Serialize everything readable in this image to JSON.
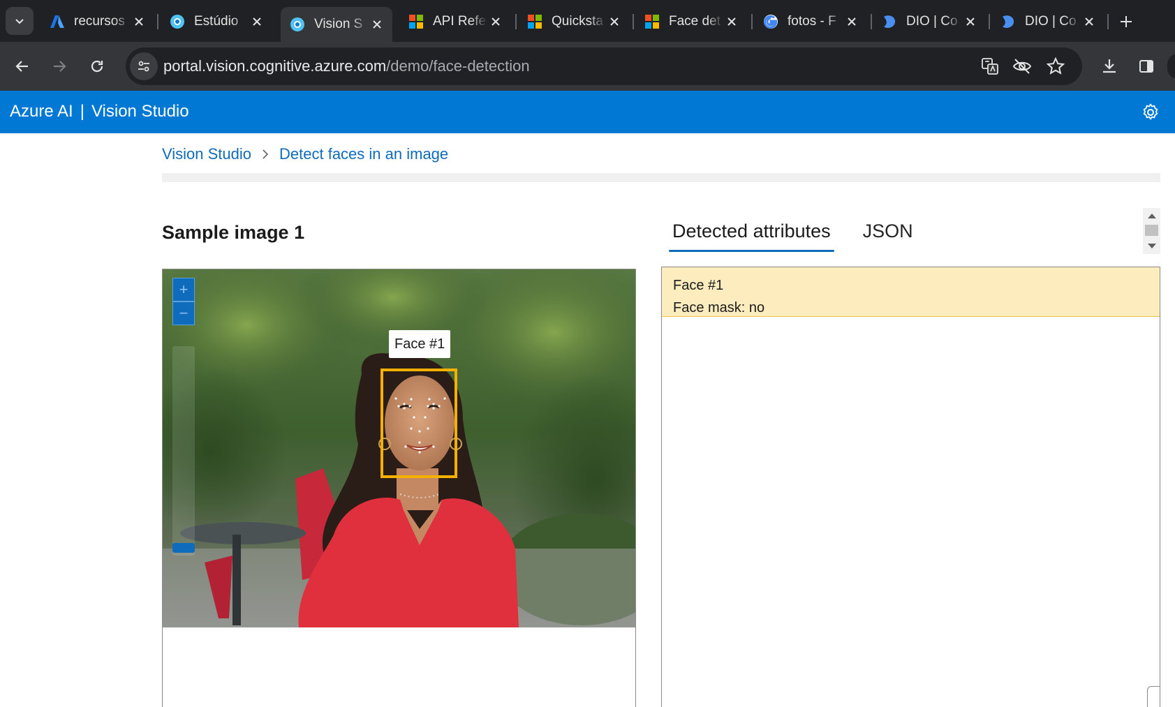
{
  "browser": {
    "tabs": [
      {
        "title": "recursos",
        "favicon": "azure-icon",
        "active": false
      },
      {
        "title": "Estúdio",
        "favicon": "vision-studio-icon",
        "active": false
      },
      {
        "title": "Vision S",
        "favicon": "vision-studio-icon",
        "active": true
      },
      {
        "title": "API Refe",
        "favicon": "microsoft-icon",
        "active": false
      },
      {
        "title": "Quicksta",
        "favicon": "microsoft-icon",
        "active": false
      },
      {
        "title": "Face det",
        "favicon": "microsoft-icon",
        "active": false
      },
      {
        "title": "fotos - F",
        "favicon": "google-icon",
        "active": false
      },
      {
        "title": "DIO | Co",
        "favicon": "dio-icon",
        "active": false
      },
      {
        "title": "DIO | Co",
        "favicon": "dio-icon",
        "active": false
      }
    ],
    "url_host": "portal.vision.cognitive.azure.com",
    "url_path": "/demo/face-detection"
  },
  "app": {
    "brand": "Azure AI",
    "separator": "|",
    "product": "Vision Studio"
  },
  "breadcrumb": {
    "root": "Vision Studio",
    "current": "Detect faces in an image"
  },
  "sample": {
    "title": "Sample image 1",
    "zoom_in": "+",
    "zoom_out": "−",
    "face_label": "Face #1"
  },
  "results": {
    "tabs": [
      {
        "label": "Detected attributes",
        "selected": true
      },
      {
        "label": "JSON",
        "selected": false
      }
    ],
    "faces": [
      {
        "name": "Face #1",
        "mask": "Face mask: no"
      }
    ]
  },
  "colors": {
    "brand_blue": "#0078d4",
    "face_box": "#f5b000",
    "highlight": "#fdecbe"
  }
}
